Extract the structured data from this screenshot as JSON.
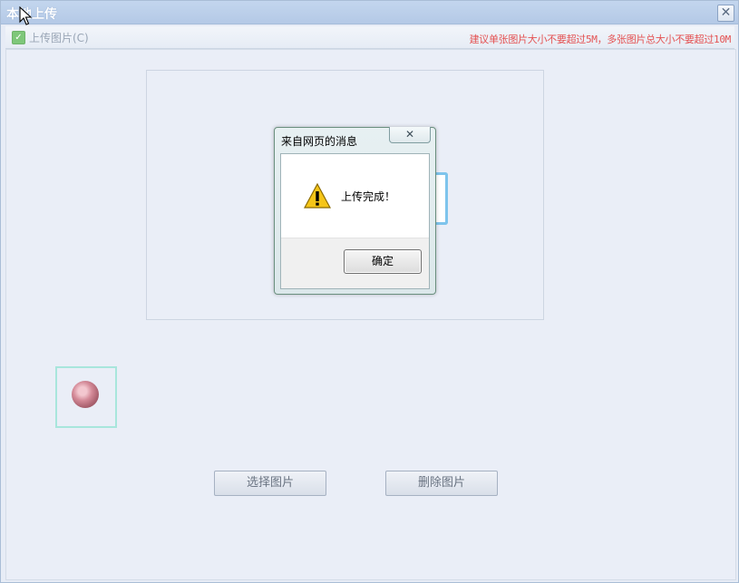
{
  "window": {
    "title": "本地上传",
    "close_glyph": "✕"
  },
  "toolbar": {
    "upload_label": "上传图片(C)",
    "hint": "建议单张图片大小不要超过5M，多张图片总大小不要超过10M"
  },
  "buttons": {
    "select": "选择图片",
    "delete": "删除图片"
  },
  "dialog": {
    "title": "来自网页的消息",
    "close_glyph": "✕",
    "message": "上传完成！",
    "ok": "确定"
  },
  "icons": {
    "warning": "warning-icon",
    "checkbox": "checkmark-icon",
    "cursor": "mouse-cursor-icon"
  },
  "colors": {
    "hint_red": "#e45252",
    "titlebar": "#b4c9e6"
  }
}
